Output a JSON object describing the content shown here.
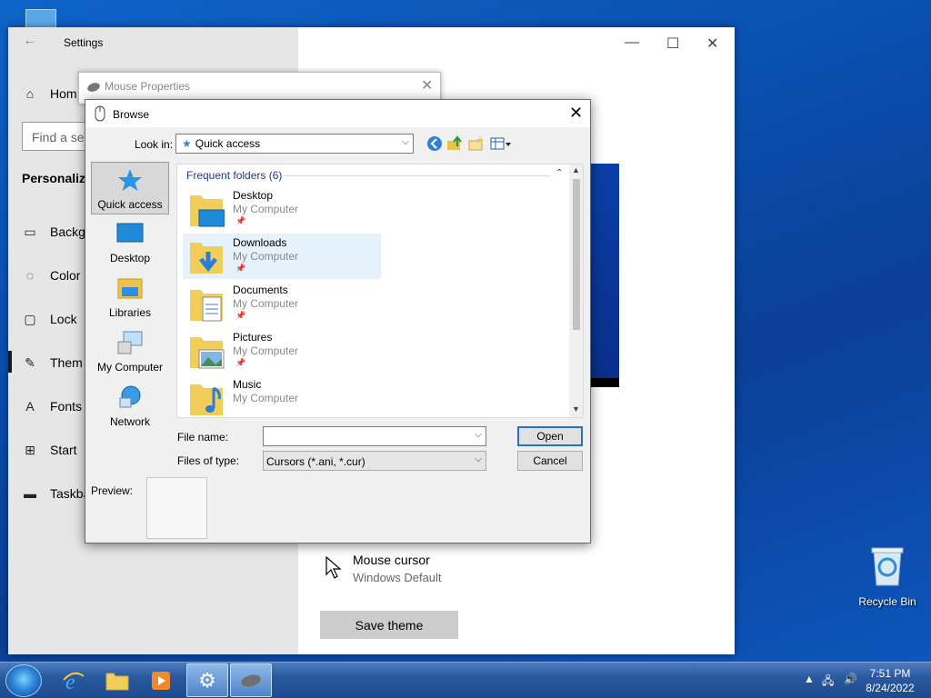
{
  "settings": {
    "title": "Settings",
    "nav": [
      "Hom",
      "Backg",
      "Color",
      "Lock",
      "Them",
      "Fonts",
      "Start",
      "Taskba"
    ],
    "search_placeholder": "Find a se",
    "section": "Personaliz",
    "cursor_title": "Mouse cursor",
    "cursor_value": "Windows Default",
    "save_theme": "Save theme"
  },
  "mouse_properties": {
    "title": "Mouse Properties"
  },
  "browse": {
    "title": "Browse",
    "look_in_label": "Look in:",
    "look_in_value": "Quick access",
    "places": [
      "Quick access",
      "Desktop",
      "Libraries",
      "My Computer",
      "Network"
    ],
    "group_header": "Frequent folders (6)",
    "items": [
      {
        "name": "Desktop",
        "location": "My Computer"
      },
      {
        "name": "Downloads",
        "location": "My Computer"
      },
      {
        "name": "Documents",
        "location": "My Computer"
      },
      {
        "name": "Pictures",
        "location": "My Computer"
      },
      {
        "name": "Music",
        "location": "My Computer"
      }
    ],
    "file_name_label": "File name:",
    "file_name_value": "",
    "files_of_type_label": "Files of type:",
    "files_of_type_value": "Cursors (*.ani, *.cur)",
    "open": "Open",
    "cancel": "Cancel",
    "preview_label": "Preview:"
  },
  "desktop": {
    "recycle_bin": "Recycle Bin"
  },
  "taskbar": {
    "time": "7:51 PM",
    "date": "8/24/2022"
  },
  "colors": {
    "accent": "#2a6fd0",
    "hover": "#e5f1fb",
    "group_header": "#1e3c8c"
  }
}
